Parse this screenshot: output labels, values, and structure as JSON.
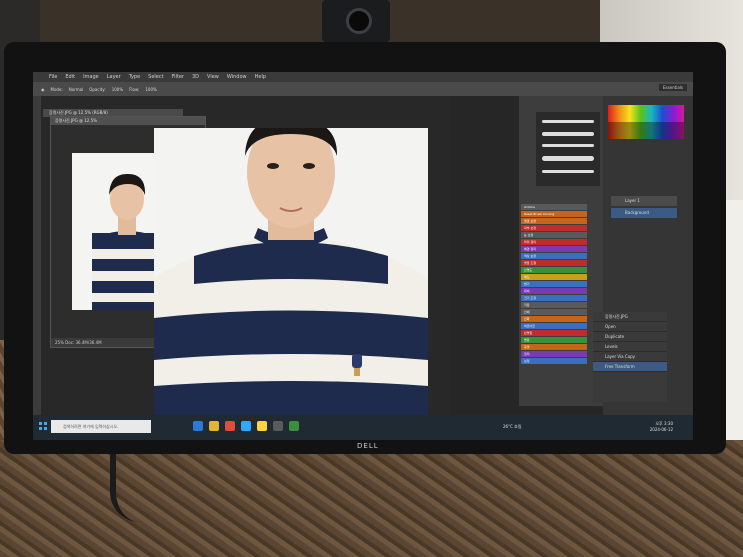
{
  "colors": {
    "wall": "#e6e4dc",
    "bezel": "#121212",
    "screen": "#262626",
    "shirt_navy": "#1f2b4d",
    "shirt_white": "#f4f2ea",
    "skin": "#e7c2a4",
    "hair": "#1a1715"
  },
  "monitor": {
    "brand": "DELL"
  },
  "photoshop": {
    "menu": [
      "File",
      "Edit",
      "Image",
      "Layer",
      "Type",
      "Select",
      "Filter",
      "3D",
      "View",
      "Window",
      "Help"
    ],
    "options": [
      "Mode:",
      "Normal",
      "Opacity:",
      "100%",
      "Flow:",
      "100%"
    ],
    "workspace": "Essentials",
    "doc_tab": "증명사진.JPG @ 12.5% (RGB/8)",
    "small_doc_title": "증명사진.JPG @ 12.5%",
    "small_status": "25%   Doc: 36.4M/36.4M",
    "actions": [
      {
        "label": "Actions",
        "color": "#5a5a5a"
      },
      {
        "label": "Reset Brush Cloning",
        "color": "#c7641b"
      },
      {
        "label": "얼굴 보정",
        "color": "#c7641b"
      },
      {
        "label": "피부 보정",
        "color": "#c02b2b"
      },
      {
        "label": "눈 보정",
        "color": "#5a5a5a"
      },
      {
        "label": "머리 정리",
        "color": "#c02b2b"
      },
      {
        "label": "배경 정리",
        "color": "#7a3bb0"
      },
      {
        "label": "색상 보정",
        "color": "#3a6fc0"
      },
      {
        "label": "명암 조절",
        "color": "#c02b2b"
      },
      {
        "label": "선명도",
        "color": "#3a8f3a"
      },
      {
        "label": "채도",
        "color": "#c7a01b"
      },
      {
        "label": "밝기",
        "color": "#3a6fc0"
      },
      {
        "label": "대비",
        "color": "#7a3bb0"
      },
      {
        "label": "크기 조정",
        "color": "#3a6fc0"
      },
      {
        "label": "저장",
        "color": "#5a5a5a"
      },
      {
        "label": "인쇄",
        "color": "#5a5a5a"
      },
      {
        "label": "인화",
        "color": "#c7641b"
      },
      {
        "label": "여권사진",
        "color": "#3a6fc0"
      },
      {
        "label": "반명함",
        "color": "#c02b2b"
      },
      {
        "label": "명함",
        "color": "#3a8f3a"
      },
      {
        "label": "증명",
        "color": "#c7641b"
      },
      {
        "label": "정리",
        "color": "#7a3bb0"
      },
      {
        "label": "보정",
        "color": "#3a6fc0"
      }
    ],
    "layers": [
      "Layer 1",
      "Background"
    ],
    "history": [
      "증명사진.JPG",
      "Open",
      "Duplicate",
      "Levels",
      "Layer Via Copy",
      "Free Transform"
    ]
  },
  "taskbar": {
    "search_placeholder": "검색하려면 여기에 입력하십시오.",
    "weather": "26°C 흐림",
    "time": "오후 3:30",
    "date": "2024-06-12"
  }
}
